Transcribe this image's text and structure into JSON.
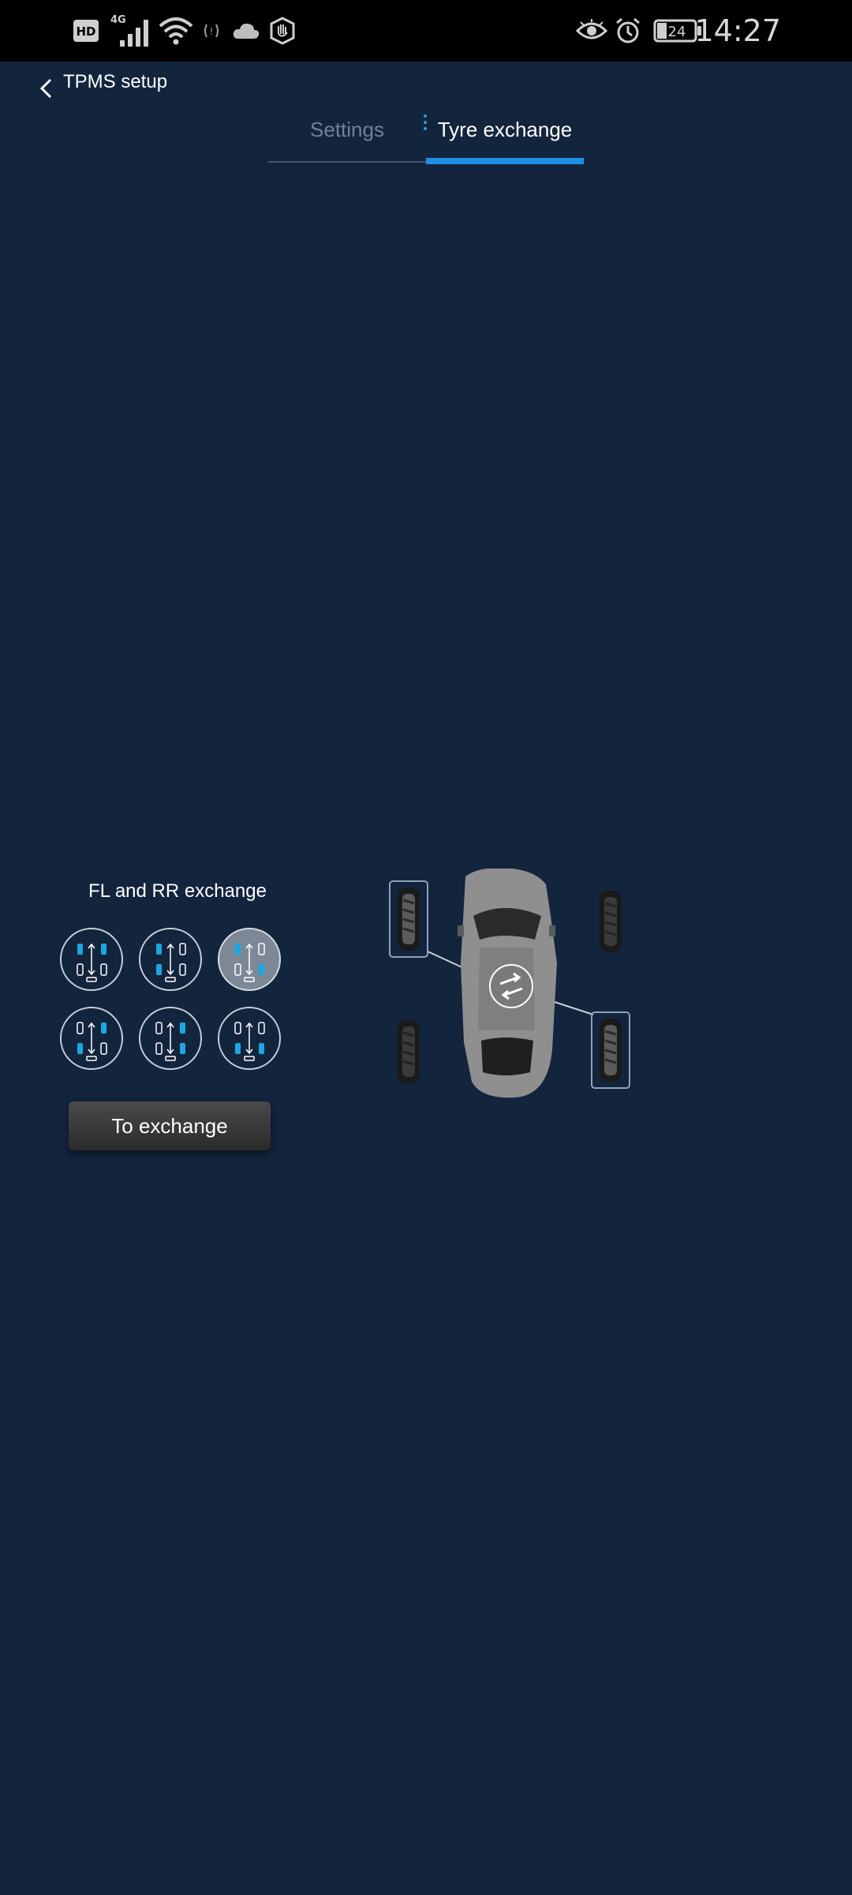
{
  "status_bar": {
    "left_icons": [
      "hd-icon",
      "4g-signal-icon",
      "wifi-icon",
      "tpms-icon",
      "cloud-icon",
      "hand-icon"
    ],
    "network_label": "4G",
    "hd_label": "HD",
    "right_icons": [
      "eye-icon",
      "alarm-icon",
      "battery-icon"
    ],
    "battery_level": "24",
    "time": "14:27"
  },
  "header": {
    "title": "TPMS setup"
  },
  "tabs": [
    {
      "label": "Settings",
      "active": false
    },
    {
      "label": "Tyre exchange",
      "active": true
    }
  ],
  "exchange": {
    "current_mode_label": "FL and RR exchange",
    "selected_option_index": 2,
    "options_count": 6,
    "button_label": "To exchange"
  },
  "colors": {
    "background": "#13243d",
    "accent": "#1e8fe6",
    "tyre_marker": "#1ba6e6"
  }
}
